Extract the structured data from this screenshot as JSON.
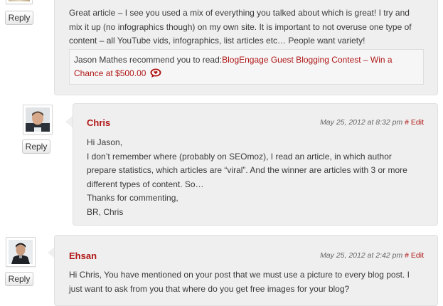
{
  "comment1": {
    "reply_label": "Reply",
    "lines": [
      "Great article – I see you used a mix of everything you talked about which is great! I try and",
      "mix it up (no infographics though) on my own site. It is important to not overuse one type of",
      "content – all YouTube vids, infographics, list articles etc… People want variety!"
    ],
    "commentluv": {
      "prefix": "Jason Mathes recommend you to read:",
      "link_line1": "BlogEngage Guest Blogging Contest – Win a",
      "link_line2": "Chance at $500.00",
      "heart_icon": "commentluv-heart-icon"
    }
  },
  "comment2": {
    "author": "Chris",
    "date": "May 25, 2012 at 8:32 pm",
    "permalink": "#",
    "edit": "Edit",
    "reply_label": "Reply",
    "lines": [
      "Hi Jason,",
      "I don’t remember where (probably on SEOmoz), I read an article, in which author",
      "prepare statistics, which articles are “viral”. And the winner are articles with 3 or more",
      "different types of content. So…",
      "Thanks for commenting,",
      "BR, Chris"
    ]
  },
  "comment3": {
    "author": "Ehsan",
    "date": "May 25, 2012 at 2:42 pm",
    "permalink": "#",
    "edit": "Edit",
    "reply_label": "Reply",
    "lines": [
      "Hi Chris, You have mentioned on your post that we must use a picture to every blog post. I",
      "just want to ask from you that where do you get free images for your blog?"
    ]
  },
  "colors": {
    "accent": "#b01717",
    "bubble_bg": "#efefef",
    "text": "#3a3a3a"
  }
}
